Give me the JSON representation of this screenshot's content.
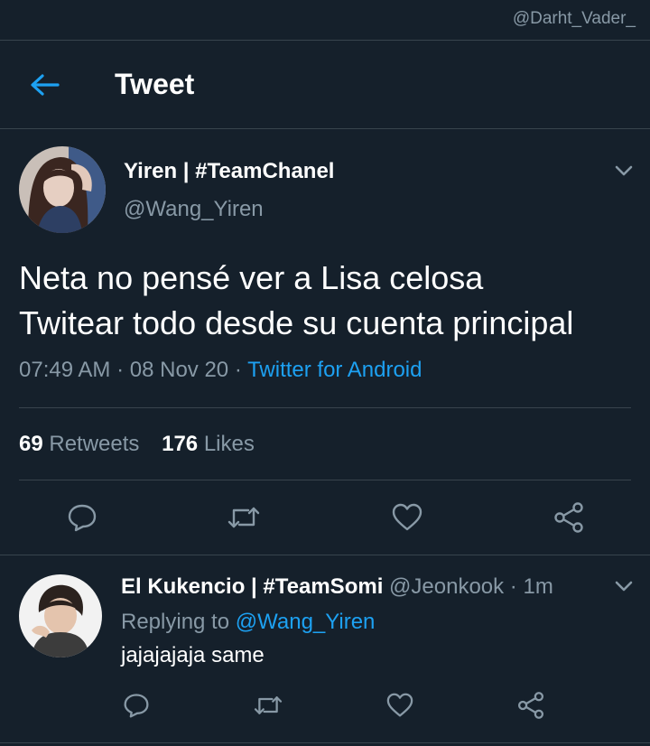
{
  "watermark": "@Darht_Vader_",
  "header": {
    "title": "Tweet"
  },
  "tweet": {
    "display_name": "Yiren | #TeamChanel",
    "handle": "@Wang_Yiren",
    "text_line1": "Neta no pensé ver a Lisa celosa",
    "text_line2": "Twitear todo desde su cuenta principal",
    "time": "07:49 AM",
    "date": "08 Nov 20",
    "source": "Twitter for Android",
    "retweet_count": "69",
    "retweet_label": "Retweets",
    "like_count": "176",
    "like_label": "Likes"
  },
  "reply": {
    "display_name": "El Kukencio | #TeamSomi",
    "handle": "@Jeonkook",
    "time": "1m",
    "replying_prefix": "Replying to",
    "replying_to": "@Wang_Yiren",
    "text": "jajajajaja same"
  },
  "icons": {
    "back": "arrow-left-icon",
    "caret": "chevron-down-icon",
    "reply": "comment-icon",
    "retweet": "retweet-icon",
    "like": "heart-icon",
    "share": "share-icon"
  },
  "colors": {
    "background": "#15202b",
    "accent": "#1da1f2",
    "muted": "#8899a6",
    "divider": "#38444d"
  }
}
